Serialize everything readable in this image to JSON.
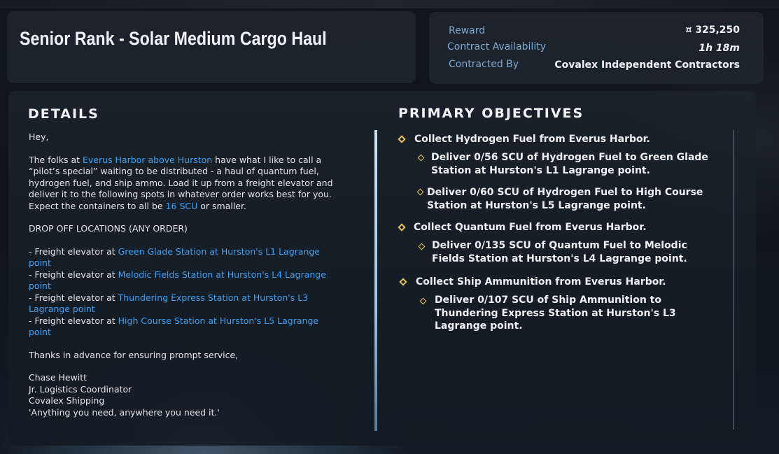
{
  "header": {
    "title": "Senior Rank - Solar Medium Cargo Haul"
  },
  "info": {
    "reward_label": "Reward",
    "reward_value": "¤ 325,250",
    "availability_label": "Contract Availability",
    "availability_value": "1h 18m",
    "contracted_by_label": "Contracted By",
    "contracted_by_value": "Covalex Independent Contractors"
  },
  "details": {
    "heading": "DETAILS",
    "greeting": "Hey,",
    "p1_a": "The folks at ",
    "p1_link": "Everus Harbor above Hurston",
    "p1_b": " have what I like to call a “pilot’s special” waiting to be distributed - a haul of quantum fuel, hydrogen fuel, and ship ammo. Load it up from a freight elevator and deliver it to the following spots in whatever order works best for you. Expect the containers to all be ",
    "p1_size": "16 SCU",
    "p1_c": " or smaller.",
    "dropoff_heading": "DROP OFF LOCATIONS (ANY ORDER)",
    "locations": [
      {
        "prefix": "- Freight elevator at ",
        "place": "Green Glade Station at Hurston's L1 Lagrange point"
      },
      {
        "prefix": "- Freight elevator at ",
        "place": "Melodic Fields Station at Hurston's L4 Lagrange point"
      },
      {
        "prefix": "- Freight elevator at ",
        "place": "Thundering Express Station at Hurston's L3 Lagrange point"
      },
      {
        "prefix": "- Freight elevator at ",
        "place": "High Course Station at Hurston's L5 Lagrange point"
      }
    ],
    "thanks": "Thanks in advance for ensuring prompt service,",
    "signature": [
      "Chase Hewitt",
      "Jr. Logistics Coordinator",
      "Covalex Shipping",
      "'Anything you need, anywhere you need it.'"
    ]
  },
  "objectives": {
    "heading": "PRIMARY OBJECTIVES",
    "items": [
      {
        "text": "Collect Hydrogen Fuel from Everus Harbor."
      },
      {
        "text_1": "Deliver 0/56 SCU of Hydrogen Fuel to Green Glade",
        "text_2": "Station at Hurston's L1 Lagrange point."
      },
      {
        "text_1": "Deliver 0/60 SCU of Hydrogen Fuel to High Course",
        "text_2": "Station at Hurston's L5 Lagrange point."
      },
      {
        "text": "Collect Quantum Fuel from Everus Harbor."
      },
      {
        "text_1": "Deliver 0/135 SCU of Quantum Fuel to Melodic",
        "text_2": "Fields Station at Hurston's L4 Lagrange point."
      },
      {
        "text": "Collect Ship Ammunition from Everus Harbor."
      },
      {
        "text_1": "Deliver 0/107 SCU of Ship Ammunition to",
        "text_2": "Thundering Express Station at Hurston's L3",
        "text_3": "Lagrange point."
      }
    ]
  },
  "colors": {
    "accent_link": "#3fa0f2",
    "label_blue": "#7fa9cf",
    "objective_marker": "#e8c35a"
  }
}
